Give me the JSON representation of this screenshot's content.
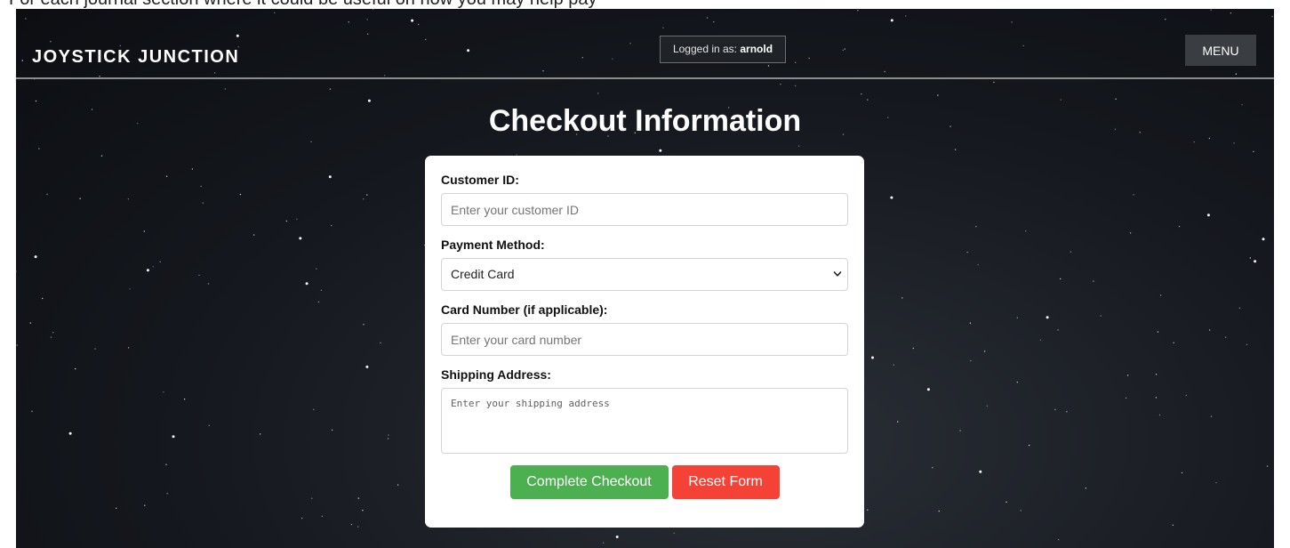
{
  "window": {
    "top_strip_text": "For each journal section where it could be useful on how you may help pay"
  },
  "header": {
    "brand": "JOYSTICK JUNCTION",
    "login_prefix": "Logged in as: ",
    "login_user": "arnold",
    "menu_label": "MENU"
  },
  "main": {
    "title": "Checkout Information"
  },
  "form": {
    "customer_id": {
      "label": "Customer ID:",
      "placeholder": "Enter your customer ID",
      "value": ""
    },
    "payment_method": {
      "label": "Payment Method:",
      "selected": "Credit Card"
    },
    "card_number": {
      "label": "Card Number (if applicable):",
      "placeholder": "Enter your card number",
      "value": ""
    },
    "shipping_address": {
      "label": "Shipping Address:",
      "placeholder": "Enter your shipping address",
      "value": ""
    },
    "complete_label": "Complete Checkout",
    "reset_label": "Reset Form"
  },
  "colors": {
    "complete_button": "#4caf50",
    "reset_button": "#f44336",
    "background": "#15181e"
  }
}
